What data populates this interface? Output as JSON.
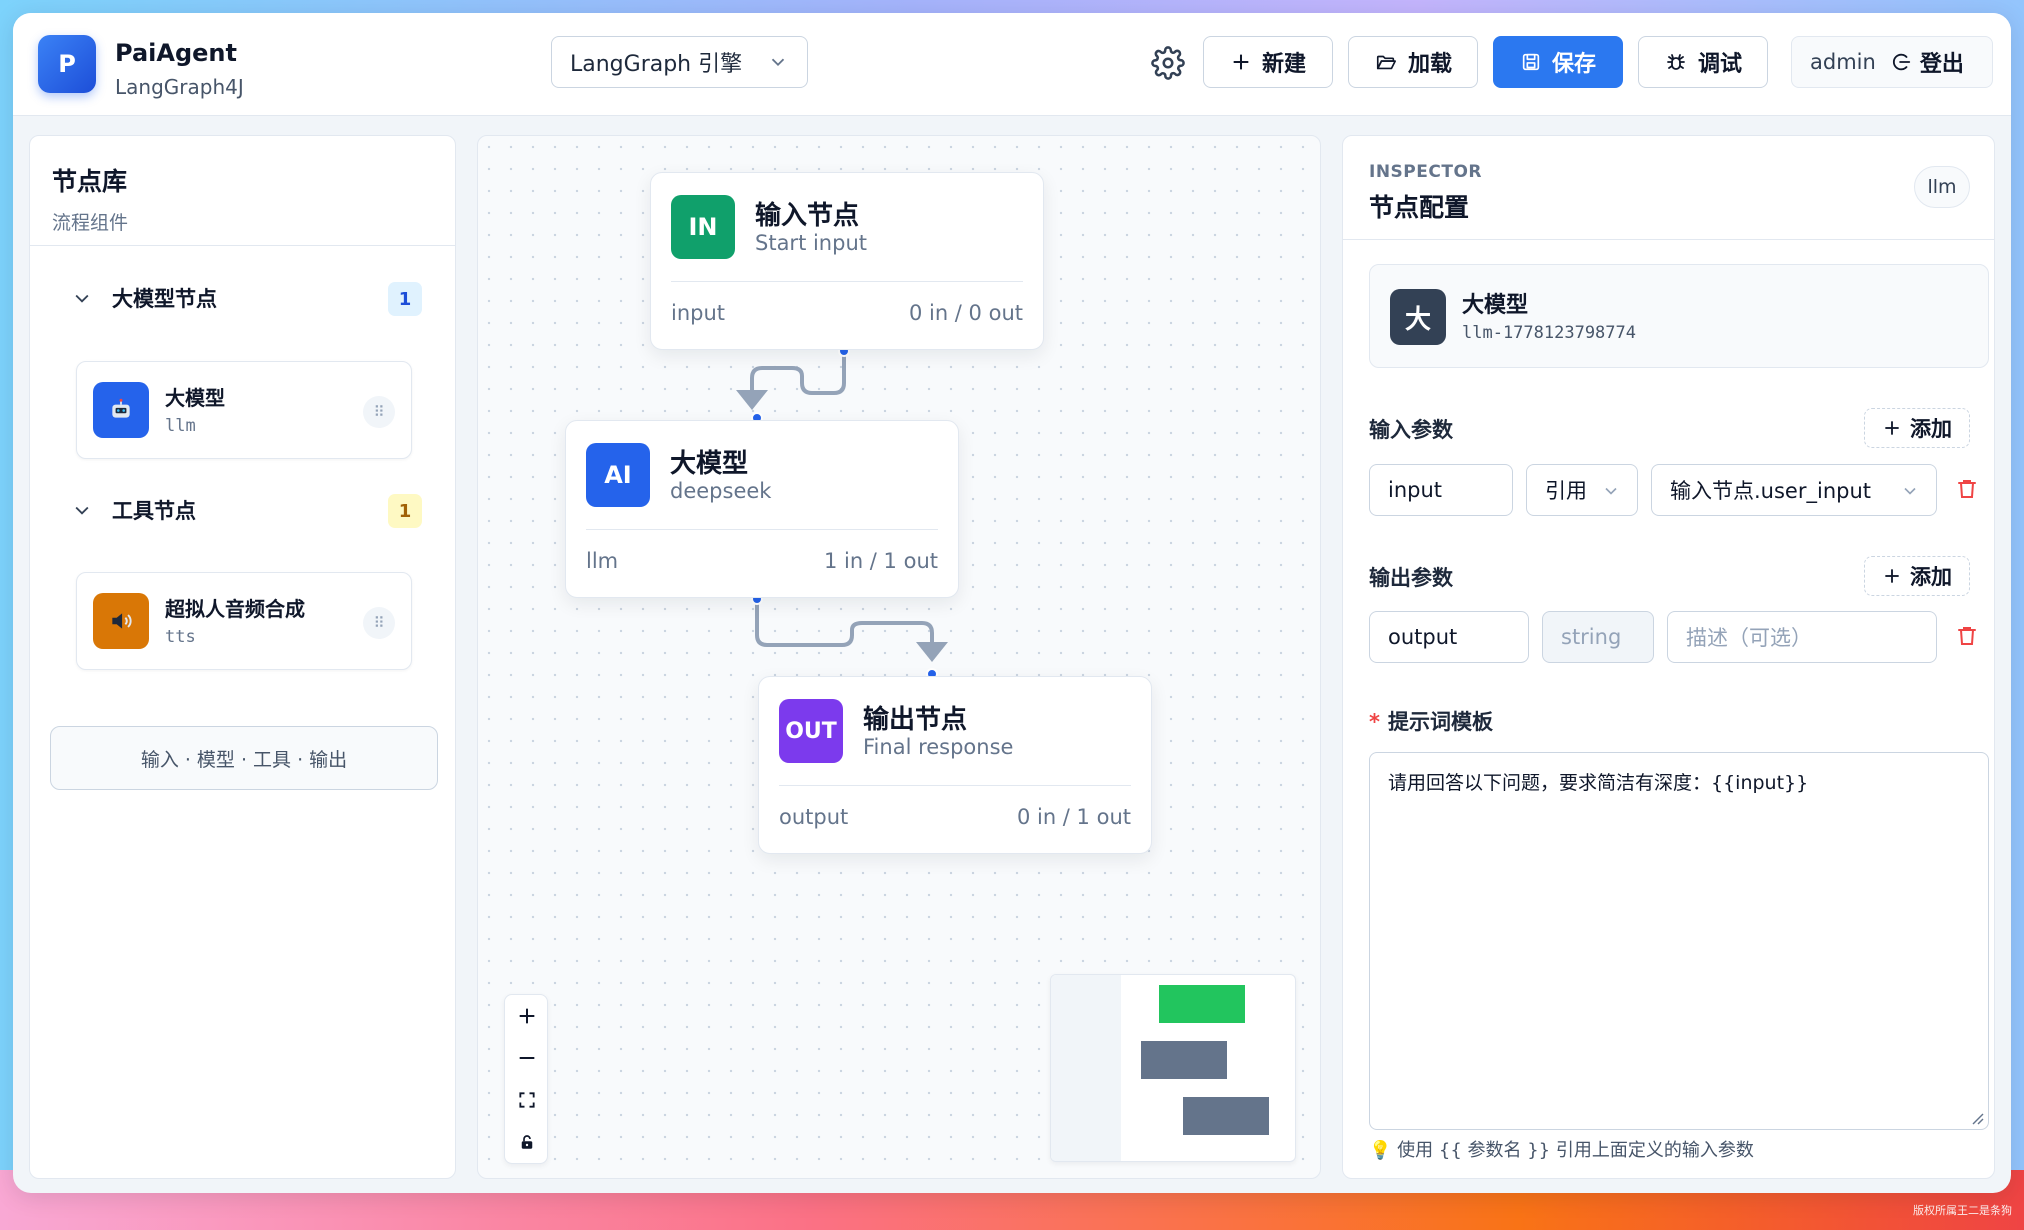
{
  "header": {
    "logo_letter": "P",
    "app_name": "PaiAgent",
    "app_subtitle": "LangGraph4J",
    "engine_select": "LangGraph 引擎",
    "buttons": {
      "new": "新建",
      "load": "加载",
      "save": "保存",
      "debug": "调试"
    },
    "user": "admin",
    "logout": "登出"
  },
  "library": {
    "title": "节点库",
    "subtitle": "流程组件",
    "groups": [
      {
        "name": "大模型节点",
        "count": "1",
        "items": [
          {
            "name": "大模型",
            "code": "llm",
            "icon": "robot-icon",
            "color": "#2563eb"
          }
        ]
      },
      {
        "name": "工具节点",
        "count": "1",
        "items": [
          {
            "name": "超拟人音频合成",
            "code": "tts",
            "icon": "speaker-icon",
            "color": "#d97706"
          }
        ]
      }
    ],
    "legend": "输入 · 模型 · 工具 · 输出"
  },
  "canvas": {
    "nodes": [
      {
        "badge": "IN",
        "title": "输入节点",
        "subtitle": "Start input",
        "type": "input",
        "io": "0 in / 0 out",
        "color": "#10a06b"
      },
      {
        "badge": "AI",
        "title": "大模型",
        "subtitle": "deepseek",
        "type": "llm",
        "io": "1 in / 1 out",
        "color": "#2563eb"
      },
      {
        "badge": "OUT",
        "title": "输出节点",
        "subtitle": "Final response",
        "type": "output",
        "io": "0 in / 1 out",
        "color": "#7c3aed"
      }
    ],
    "zoom_controls": [
      "zoom-in-icon",
      "zoom-out-icon",
      "fit-view-icon",
      "lock-icon"
    ],
    "minimap_colors": [
      "#22c55e",
      "#64748b",
      "#64748b"
    ]
  },
  "inspector": {
    "kicker": "INSPECTOR",
    "title": "节点配置",
    "tag": "llm",
    "node_name": "大模型",
    "node_icon_char": "大",
    "node_id": "llm-1778123798774",
    "input_section": "输入参数",
    "add_label": "添加",
    "input_param": {
      "name": "input",
      "mode": "引用",
      "source": "输入节点.user_input"
    },
    "output_section": "输出参数",
    "output_param": {
      "name": "output",
      "type": "string",
      "description_placeholder": "描述（可选）"
    },
    "prompt_label": "提示词模板",
    "prompt_text": "请用回答以下问题，要求简洁有深度：{{input}}",
    "hint": "使用 {{ 参数名 }} 引用上面定义的输入参数"
  },
  "watermark": "版权所属王二是条狗",
  "colors": {
    "accent": "#2b78f0",
    "danger": "#ef4444"
  }
}
